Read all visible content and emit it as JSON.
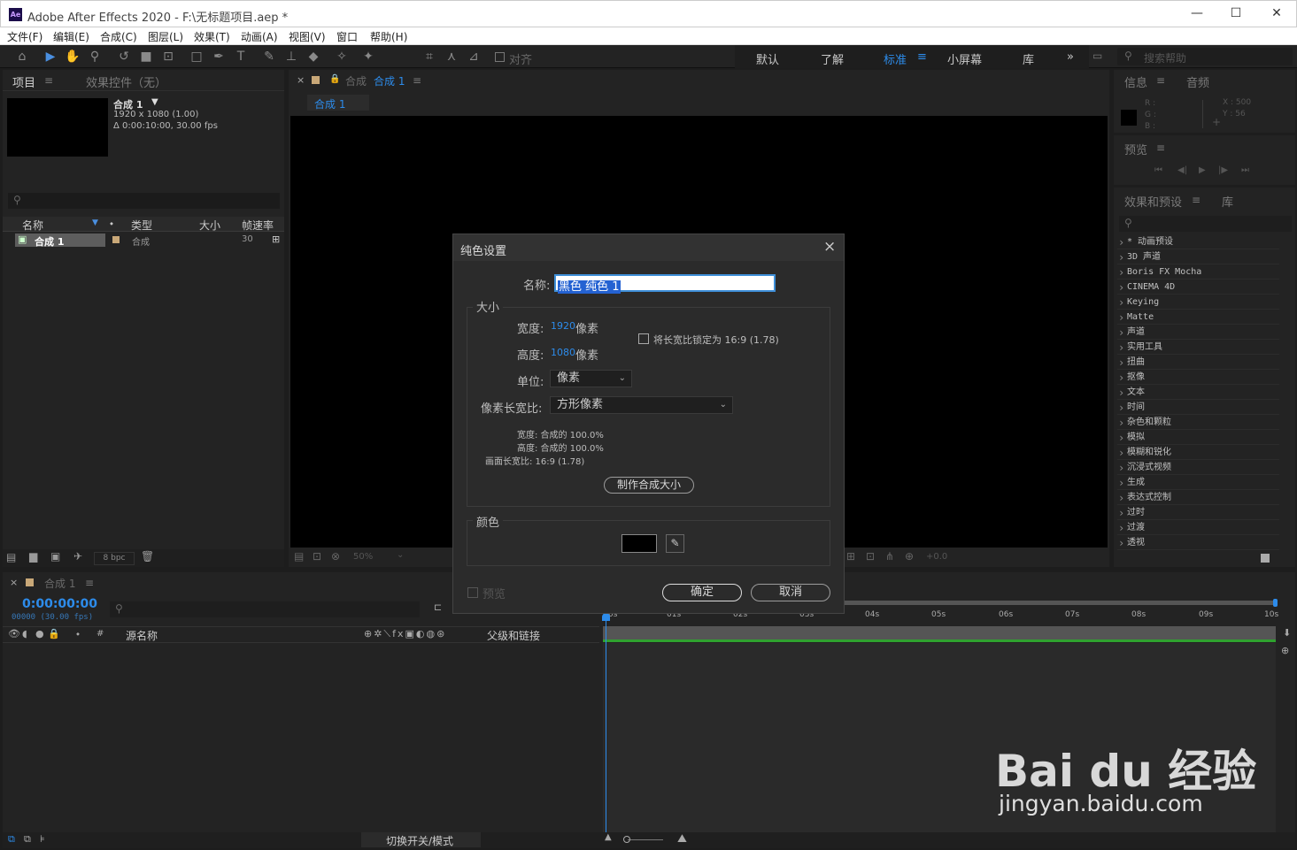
{
  "window": {
    "title": "Adobe After Effects 2020 - F:\\无标题项目.aep *",
    "logo": "Ae",
    "min": "—",
    "max": "☐",
    "close": "✕"
  },
  "menu": [
    "文件(F)",
    "编辑(E)",
    "合成(C)",
    "图层(L)",
    "效果(T)",
    "动画(A)",
    "视图(V)",
    "窗口",
    "帮助(H)"
  ],
  "toolbar": {
    "snap_label": "对齐",
    "workspaces": [
      "默认",
      "了解",
      "标准",
      "小屏幕",
      "库"
    ],
    "more": "»",
    "search_placeholder": "搜索帮助"
  },
  "project": {
    "tab_project": "项目",
    "tab_effects": "效果控件（无）",
    "comp_name": "合成 1",
    "comp_res": "1920 x 1080 (1.00)",
    "comp_dur": "Δ 0:00:10:00, 30.00 fps",
    "columns": [
      "名称",
      "类型",
      "大小",
      "帧速率"
    ],
    "item": {
      "name": "合成 1",
      "type": "合成",
      "fps": "30"
    },
    "bpc": "8 bpc"
  },
  "viewer": {
    "tab": "合成 1",
    "breadcrumb": "合成 1",
    "prefix": "合成",
    "zoom": "50%",
    "exposure": "+0.0"
  },
  "info": {
    "tab": "信息",
    "tab2": "音频",
    "r": "R :",
    "g": "G :",
    "b": "B :",
    "x": "X : 500",
    "y": "Y : 56"
  },
  "preview": {
    "tab": "预览"
  },
  "effects": {
    "tab": "效果和预设",
    "tab2": "库",
    "items": [
      "* 动画预设",
      "3D 声道",
      "Boris FX Mocha",
      "CINEMA 4D",
      "Keying",
      "Matte",
      "声道",
      "实用工具",
      "扭曲",
      "抠像",
      "文本",
      "时间",
      "杂色和颗粒",
      "模拟",
      "模糊和锐化",
      "沉浸式视频",
      "生成",
      "表达式控制",
      "过时",
      "过渡",
      "透视"
    ]
  },
  "timeline": {
    "tab": "合成 1",
    "timecode": "0:00:00:00",
    "frames": "00000 (30.00 fps)",
    "col_source": "源名称",
    "col_parent": "父级和链接",
    "toggle": "切换开关/模式",
    "ticks": [
      "0s",
      "01s",
      "02s",
      "03s",
      "04s",
      "05s",
      "06s",
      "07s",
      "08s",
      "09s",
      "10s"
    ]
  },
  "dialog": {
    "title": "纯色设置",
    "name_label": "名称:",
    "name_value": "黑色 纯色 1",
    "size_label": "大小",
    "width_label": "宽度:",
    "width_value": "1920",
    "height_label": "高度:",
    "height_value": "1080",
    "px": "像素",
    "lock_label": "将长宽比锁定为 16:9 (1.78)",
    "unit_label": "单位:",
    "unit_value": "像素",
    "par_label": "像素长宽比:",
    "par_value": "方形像素",
    "pct_w": "宽度: 合成的 100.0%",
    "pct_h": "高度: 合成的 100.0%",
    "frame_ar": "画面长宽比: 16:9 (1.78)",
    "make_comp": "制作合成大小",
    "color_label": "颜色",
    "preview_label": "预览",
    "ok": "确定",
    "cancel": "取消"
  },
  "watermark": {
    "brand": "Bai du 经验",
    "url": "jingyan.baidu.com"
  }
}
